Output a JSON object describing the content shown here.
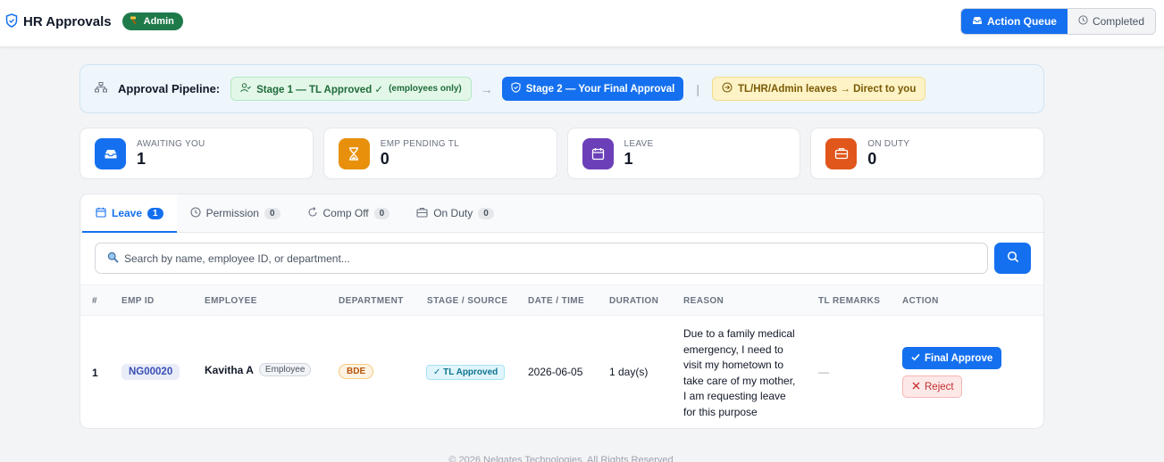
{
  "header": {
    "title": "HR Approvals",
    "role_badge": "Admin",
    "view_toggle": [
      {
        "label": "Action Queue",
        "icon": "inbox-icon",
        "active": true
      },
      {
        "label": "Completed",
        "icon": "clock-icon",
        "active": false
      }
    ]
  },
  "pipeline": {
    "label": "Approval Pipeline:",
    "stage1": "Stage 1 — TL Approved ✓",
    "stage1_note": "(employees only)",
    "arrow": "→",
    "stage2": "Stage 2 — Your Final Approval",
    "separator": "|",
    "direct": "TL/HR/Admin leaves → Direct to you"
  },
  "stats": [
    {
      "label": "AWAITING YOU",
      "value": "1",
      "color": "#1570ef",
      "icon": "inbox-icon"
    },
    {
      "label": "EMP PENDING TL",
      "value": "0",
      "color": "#e8900c",
      "icon": "hourglass-icon"
    },
    {
      "label": "LEAVE",
      "value": "1",
      "color": "#6b3fb8",
      "icon": "calendar-icon"
    },
    {
      "label": "ON DUTY",
      "value": "0",
      "color": "#e0561b",
      "icon": "briefcase-icon"
    }
  ],
  "tabs": [
    {
      "label": "Leave",
      "count": "1",
      "active": true
    },
    {
      "label": "Permission",
      "count": "0",
      "active": false
    },
    {
      "label": "Comp Off",
      "count": "0",
      "active": false
    },
    {
      "label": "On Duty",
      "count": "0",
      "active": false
    }
  ],
  "search": {
    "placeholder": "Search by name, employee ID, or department..."
  },
  "table": {
    "columns": [
      "#",
      "EMP ID",
      "EMPLOYEE",
      "DEPARTMENT",
      "STAGE / SOURCE",
      "DATE / TIME",
      "DURATION",
      "REASON",
      "TL REMARKS",
      "ACTION"
    ],
    "rows": [
      {
        "index": "1",
        "emp_id": "NG00020",
        "name": "Kavitha A",
        "role": "Employee",
        "department": "BDE",
        "stage": "✓ TL Approved",
        "date": "2026-06-05",
        "duration": "1 day(s)",
        "reason_lines": [
          "Due to a family medical",
          "emergency, I need to",
          "visit my hometown to",
          "take care of my mother,",
          "I am requesting leave",
          "for this purpose"
        ],
        "tl_remarks": "—",
        "approve_label": "Final Approve",
        "reject_label": "Reject"
      }
    ]
  },
  "footer": "© 2026 Nelgates Technologies. All Rights Reserved"
}
